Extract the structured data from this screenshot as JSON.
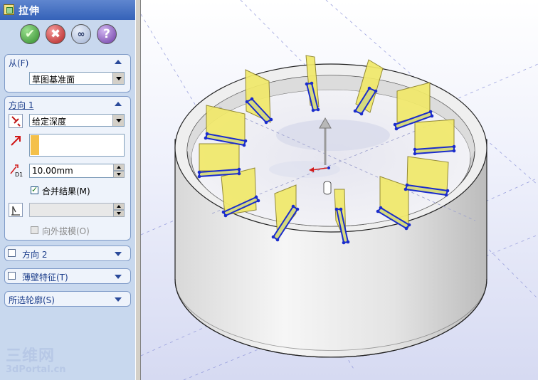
{
  "window": {
    "title": "拉伸"
  },
  "actions": {
    "ok": "✔",
    "cancel": "✖",
    "preview": "∞",
    "help": "?"
  },
  "from_group": {
    "label": "从(F)",
    "value": "草图基准面"
  },
  "direction1": {
    "label": "方向 1",
    "end_condition": "给定深度",
    "depth": "10.00mm",
    "merge_result": "合并结果(M)",
    "merge_checked": true,
    "draft_outward": "向外拔模(O)",
    "draft_checked": false,
    "draft_value": ""
  },
  "direction2": {
    "label": "方向 2",
    "checked": false
  },
  "thin_feature": {
    "label": "薄壁特征(T)",
    "checked": false
  },
  "selected_contours": {
    "label": "所选轮廓(S)"
  },
  "watermark": {
    "cn": "三维网",
    "en": "3dPortal.cn"
  },
  "colors": {
    "accent": "#f0e060",
    "sketch": "#1a2ccc",
    "panel": "#c8d8ee",
    "viewport_floor": "#d6daf2"
  },
  "icons": [
    "check-icon",
    "close-icon",
    "glasses-icon",
    "help-icon",
    "reverse-direction-icon",
    "direction-arrow-icon",
    "depth-icon",
    "draft-icon"
  ]
}
